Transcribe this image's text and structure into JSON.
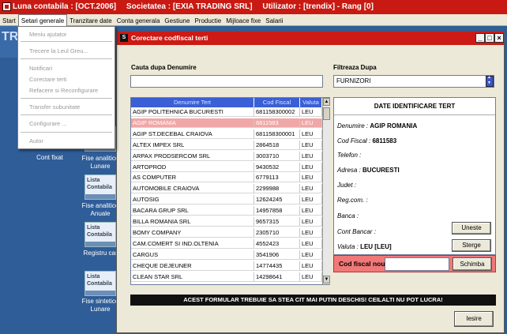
{
  "app": {
    "luna": "Luna contabila : [OCT.2006]",
    "societatea": "Societatea : [EXIA TRADING SRL]",
    "utilizator": "Utilizator : [trendix] - Rang [0]"
  },
  "menu": [
    "Start",
    "Setari generale",
    "Tranzitare date",
    "Conta generala",
    "Gestiune",
    "Productie",
    "Mijloace fixe",
    "Salarii"
  ],
  "dropdown": {
    "items": [
      "Meniu ajutator",
      "Trecere la Leul Greu...",
      "Notificari",
      "Corectare terti",
      "Refacere si Reconfigurare",
      "Transfer subunitate",
      "Configurare ...",
      "Autor"
    ]
  },
  "desktop": {
    "partial_title": "TR",
    "tile_text_1": "Lista",
    "tile_text_2": "Contabila",
    "labels": [
      "Cont fixat",
      "Fise analitice Lunare",
      "Fise analitice Anuale",
      "Registru casa",
      "Fise sintetice Lunare"
    ]
  },
  "dialog": {
    "title": "Corectare codfiscal terti",
    "search_label": "Cauta dupa Denumire",
    "search_value": "",
    "filter_label": "Filtreaza Dupa",
    "filter_value": "FURNIZORI",
    "columns": [
      "Denumire Tert",
      "Cod Fiscal",
      "Valuta"
    ],
    "rows": [
      [
        "AGIP POLITEHNICA BUCURESTI",
        "681158300002",
        "LEU"
      ],
      [
        "AGIP ROMANIA",
        "6811583",
        "LEU"
      ],
      [
        "AGIP ST.DECEBAL CRAIOVA",
        "681158300001",
        "LEU"
      ],
      [
        "ALTEX IMPEX SRL",
        "2864518",
        "LEU"
      ],
      [
        "ARPAX PRODSERCOM SRL",
        "3003710",
        "LEU"
      ],
      [
        "ARTOPROD",
        "9430532",
        "LEU"
      ],
      [
        "AS COMPUTER",
        "6779113",
        "LEU"
      ],
      [
        "AUTOMOBILE CRAIOVA",
        "2299988",
        "LEU"
      ],
      [
        "AUTOSIG",
        "12624245",
        "LEU"
      ],
      [
        "BACARA GRUP SRL",
        "14957858",
        "LEU"
      ],
      [
        "BILLA ROMANIA SRL",
        "9657315",
        "LEU"
      ],
      [
        "BOMY COMPANY",
        "2305710",
        "LEU"
      ],
      [
        "CAM.COMERT SI IND.OLTENIA",
        "4552423",
        "LEU"
      ],
      [
        "CARGUS",
        "3541906",
        "LEU"
      ],
      [
        "CHEQUE DEJEUNER",
        "14774435",
        "LEU"
      ],
      [
        "CLEAN STAR SRL",
        "14298641",
        "LEU"
      ]
    ],
    "details": {
      "header": "DATE IDENTIFICARE TERT",
      "denumire_label": "Denumire :",
      "denumire_value": "AGIP ROMANIA",
      "cod_label": "Cod Fiscal :",
      "cod_value": "6811583",
      "telefon_label": "Telefon :",
      "adresa_label": "Adresa :",
      "adresa_value": "BUCURESTI",
      "judet_label": "Judet :",
      "regcom_label": "Reg.com. :",
      "banca_label": "Banca :",
      "contbancar_label": "Cont Bancar :",
      "valuta_label": "Valuta :",
      "valuta_value": "LEU [LEU]"
    },
    "buttons": {
      "uneste": "Uneste",
      "sterge": "Sterge",
      "schimba": "Schimba",
      "iesire": "Iesire"
    },
    "cod_nou_label": "Cod fiscal nou",
    "cod_nou_value": "",
    "warning": "ACEST FORMULAR TREBUIE SA STEA CIT MAI PUTIN DESCHIS! CEILALTI NU POT LUCRA!"
  },
  "colors": {
    "title_red": "#c81a12",
    "desktop_blue": "#2f5d98",
    "header_blue": "#3b5fd6",
    "selected_row": "#f0a7a7",
    "codbar_red": "#f07878"
  }
}
